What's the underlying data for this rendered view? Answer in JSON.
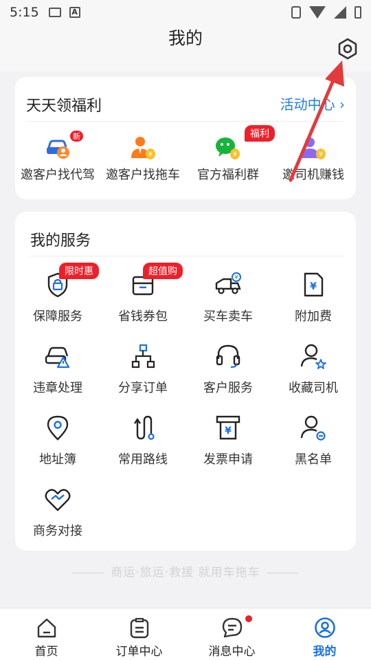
{
  "status_bar": {
    "time": "5:15"
  },
  "header": {
    "title": "我的"
  },
  "welfare": {
    "title": "天天领福利",
    "link": "活动中心",
    "items": [
      {
        "label": "邀客户找代驾",
        "badge": "新"
      },
      {
        "label": "邀客户找拖车",
        "badge": ""
      },
      {
        "label": "官方福利群",
        "badge": "福利"
      },
      {
        "label": "邀司机赚钱",
        "badge": ""
      }
    ]
  },
  "services": {
    "title": "我的服务",
    "items": [
      {
        "label": "保障服务",
        "badge": "限时惠"
      },
      {
        "label": "省钱券包",
        "badge": "超值购"
      },
      {
        "label": "买车卖车",
        "badge": ""
      },
      {
        "label": "附加费",
        "badge": ""
      },
      {
        "label": "违章处理",
        "badge": ""
      },
      {
        "label": "分享订单",
        "badge": ""
      },
      {
        "label": "客户服务",
        "badge": ""
      },
      {
        "label": "收藏司机",
        "badge": ""
      },
      {
        "label": "地址簿",
        "badge": ""
      },
      {
        "label": "常用路线",
        "badge": ""
      },
      {
        "label": "发票申请",
        "badge": ""
      },
      {
        "label": "黑名单",
        "badge": ""
      },
      {
        "label": "商务对接",
        "badge": ""
      }
    ]
  },
  "slogan": "商运·旅运·救援 就用车拖车",
  "tabs": [
    {
      "label": "首页"
    },
    {
      "label": "订单中心"
    },
    {
      "label": "消息中心"
    },
    {
      "label": "我的"
    }
  ],
  "colors": {
    "accent": "#1a6fe0",
    "badge": "#ef1f29",
    "link": "#1a7ee6"
  }
}
